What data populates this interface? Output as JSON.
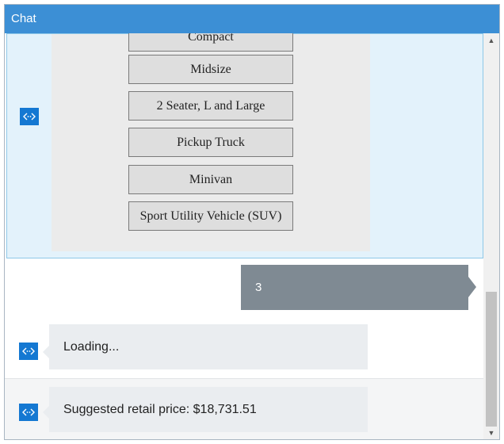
{
  "window": {
    "title": "Chat"
  },
  "choices": [
    {
      "label": "Compact"
    },
    {
      "label": "Midsize"
    },
    {
      "label": "2 Seater, L and Large"
    },
    {
      "label": "Pickup Truck"
    },
    {
      "label": "Minivan"
    },
    {
      "label": "Sport Utility Vehicle (SUV)"
    }
  ],
  "messages": {
    "user_reply": "3",
    "loading": "Loading...",
    "result": "Suggested retail price: $18,731.51"
  },
  "icons": {
    "bot": "bot-code-icon",
    "scroll_up": "chevron-up-icon",
    "scroll_down": "chevron-down-icon"
  },
  "colors": {
    "titlebar": "#3c8fd5",
    "bot_icon": "#1478d2",
    "user_bubble": "#7f8a93",
    "bot_bubble": "#eaedf0",
    "selected_highlight": "#e3f2fb"
  }
}
